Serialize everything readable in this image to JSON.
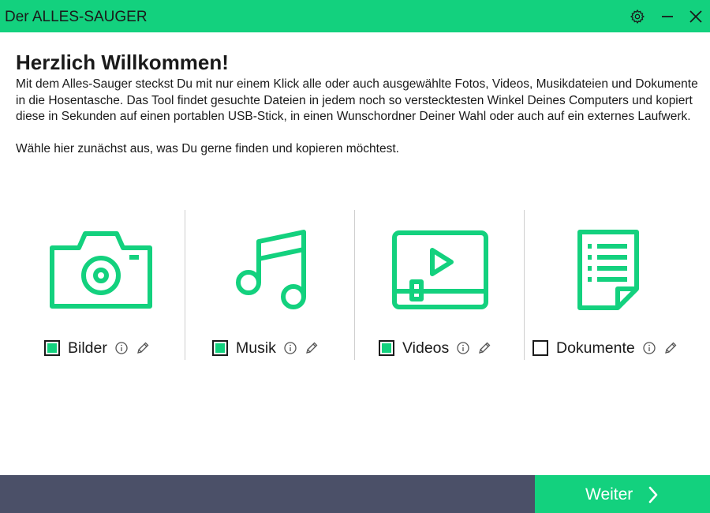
{
  "window": {
    "title": "Der ALLES-SAUGER",
    "icons": {
      "settings": "gear-icon",
      "minimize": "minimize-icon",
      "close": "close-icon"
    }
  },
  "main": {
    "heading": "Herzlich Willkommen!",
    "intro": "Mit dem Alles-Sauger steckst Du mit nur einem Klick alle oder auch ausgewählte Fotos, Videos, Musikdateien und Dokumente in die Hosentasche. Das Tool findet gesuchte Dateien in jedem noch so verstecktesten Winkel Deines Computers und kopiert diese in Sekunden auf einen portablen USB-Stick, in einen Wunschordner Deiner Wahl oder auch auf ein externes Laufwerk.",
    "instruction": "Wähle hier zunächst aus, was Du gerne finden und kopieren möchtest."
  },
  "categories": [
    {
      "label": "Bilder",
      "checked": true,
      "icon": "camera-icon"
    },
    {
      "label": "Musik",
      "checked": true,
      "icon": "music-note-icon"
    },
    {
      "label": "Videos",
      "checked": true,
      "icon": "video-player-icon"
    },
    {
      "label": "Dokumente",
      "checked": false,
      "icon": "document-icon"
    }
  ],
  "footer": {
    "next_label": "Weiter",
    "next_icon": "chevron-right-icon"
  },
  "colors": {
    "accent": "#13d17e",
    "footer_bg": "#4b5068",
    "text": "#1a1a1a"
  }
}
